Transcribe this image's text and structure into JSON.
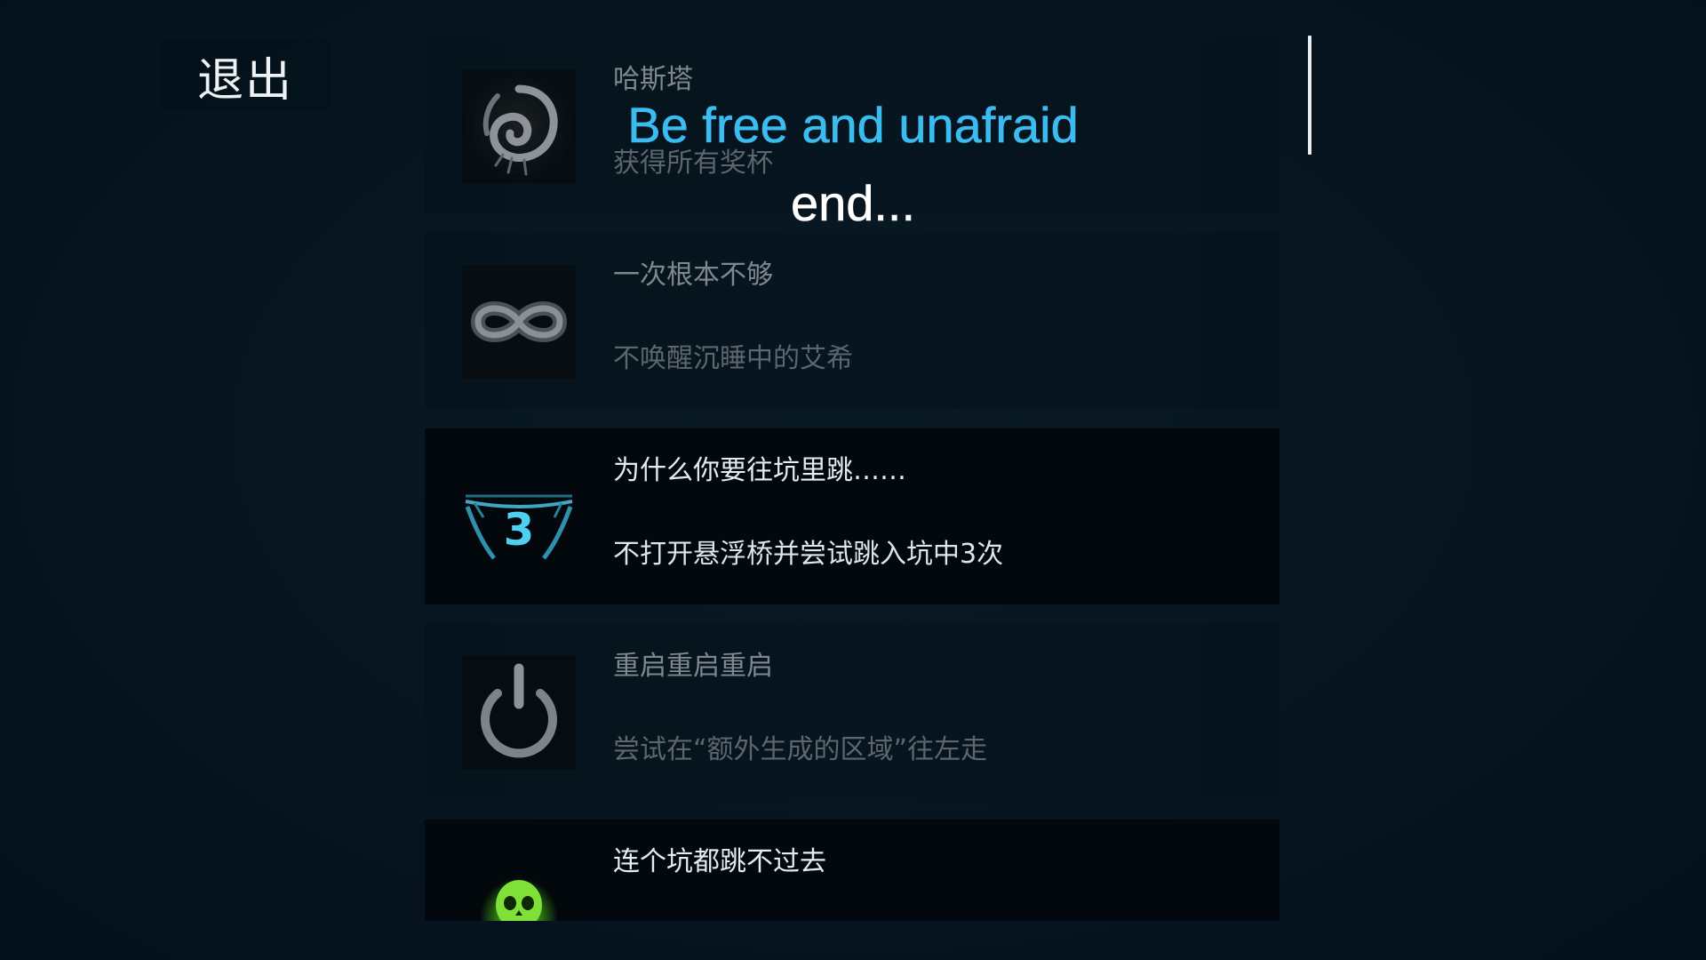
{
  "exit": {
    "label": "退出"
  },
  "achievements": [
    {
      "title": "哈斯塔",
      "description": "获得所有奖杯",
      "icon": "hastur-swirl-icon",
      "state": "locked"
    },
    {
      "title": "一次根本不够",
      "description": "不唤醒沉睡中的艾希",
      "icon": "infinity-icon",
      "state": "locked"
    },
    {
      "title": "为什么你要往坑里跳……",
      "description": "不打开悬浮桥并尝试跳入坑中3次",
      "icon": "pit-jump-3-icon",
      "state": "unlocked"
    },
    {
      "title": "重启重启重启",
      "description": "尝试在“额外生成的区域”往左走",
      "icon": "power-icon",
      "state": "locked"
    },
    {
      "title": "连个坑都跳不过去",
      "icon": "green-skull-icon",
      "state": "unlocked"
    }
  ],
  "subtitles": {
    "line1": "Be free and unafraid",
    "line2": "end..."
  },
  "colors": {
    "subtitle_accent": "#3bbcf0",
    "background": "#071521",
    "card_unlocked": "#02080d",
    "card_locked": "#061520"
  }
}
